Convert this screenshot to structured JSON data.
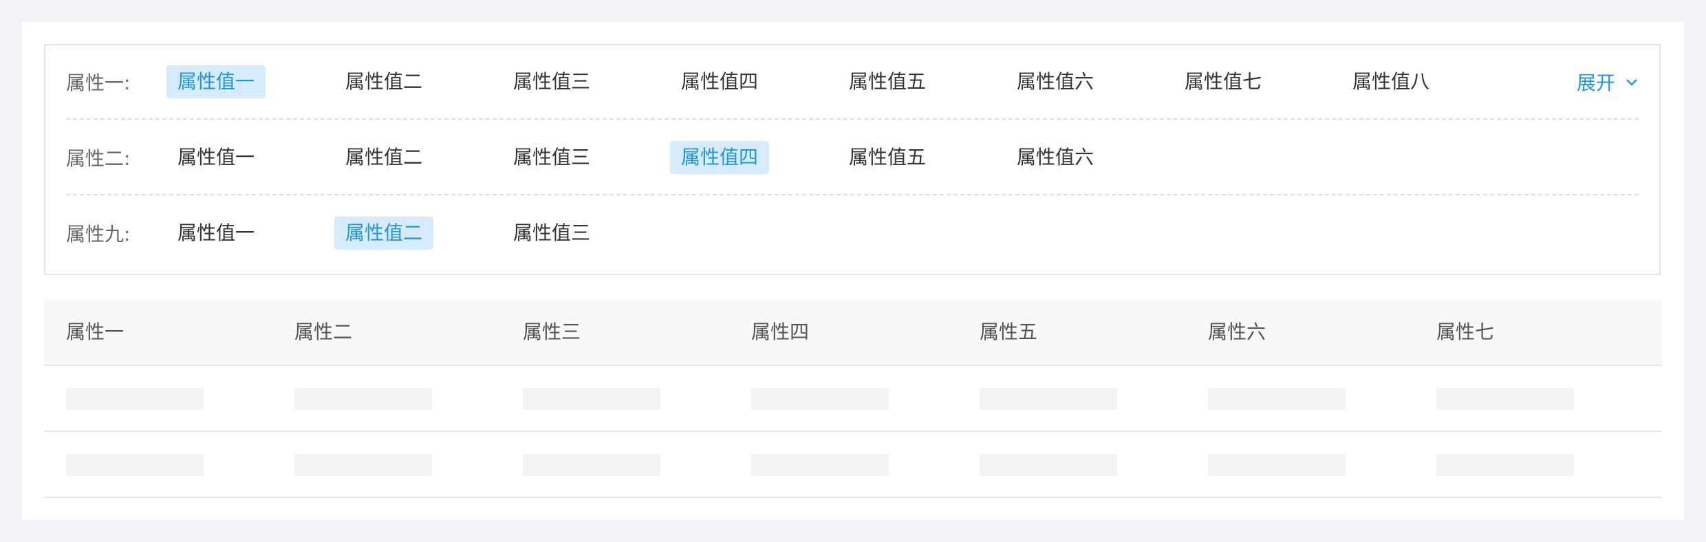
{
  "filter": {
    "expand_label": "展开",
    "rows": [
      {
        "label": "属性一:",
        "options": [
          "属性值一",
          "属性值二",
          "属性值三",
          "属性值四",
          "属性值五",
          "属性值六",
          "属性值七",
          "属性值八"
        ],
        "selected": 0
      },
      {
        "label": "属性二:",
        "options": [
          "属性值一",
          "属性值二",
          "属性值三",
          "属性值四",
          "属性值五",
          "属性值六"
        ],
        "selected": 3
      },
      {
        "label": "属性九:",
        "options": [
          "属性值一",
          "属性值二",
          "属性值三"
        ],
        "selected": 1
      }
    ]
  },
  "table": {
    "columns": [
      "属性一",
      "属性二",
      "属性三",
      "属性四",
      "属性五",
      "属性六",
      "属性七"
    ],
    "rows_state": [
      "loading",
      "loading"
    ]
  },
  "colors": {
    "accent": "#2196d9",
    "active_bg": "#d6ebfb",
    "placeholder": "#f2f2f2"
  },
  "icons": {
    "expand": "chevron-down-icon"
  }
}
